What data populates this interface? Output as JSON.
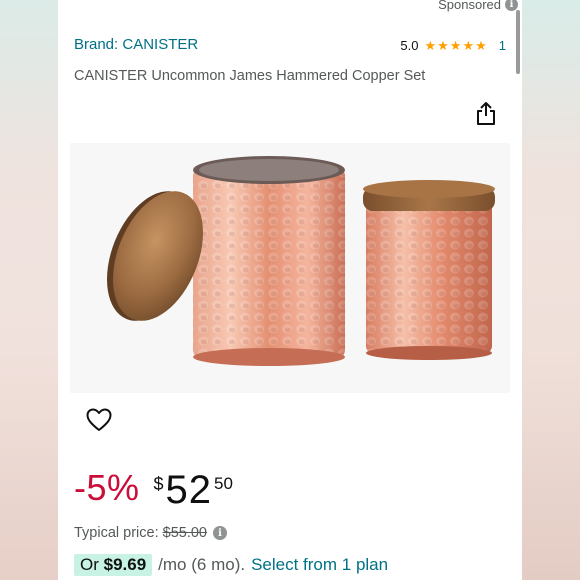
{
  "sponsored": {
    "label": "Sponsored"
  },
  "brand": {
    "label": "Brand: CANISTER"
  },
  "rating": {
    "value": "5.0",
    "stars": 5,
    "count": "1"
  },
  "product": {
    "title": "CANISTER Uncommon James Hammered Copper Set"
  },
  "icons": {
    "share": "share-icon",
    "wishlist": "heart-icon",
    "info": "info-icon"
  },
  "price": {
    "discount": "-5%",
    "currency": "$",
    "whole": "52",
    "fraction": "50",
    "typical_label": "Typical price:",
    "typical_value": "$55.00"
  },
  "installment": {
    "prefix": "Or",
    "amount": "$9.69",
    "suffix": "/mo (6 mo).",
    "link": "Select from 1 plan"
  },
  "colors": {
    "link": "#007185",
    "discount": "#cc0c39",
    "star": "#ff9f00",
    "badge": "#c8f2e4"
  }
}
